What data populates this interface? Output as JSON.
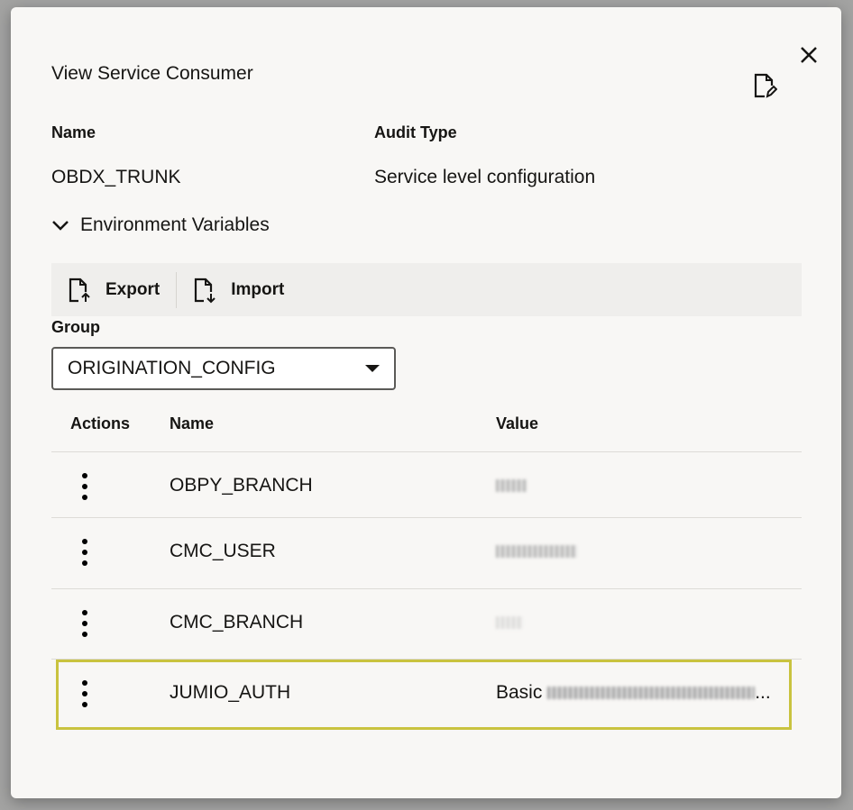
{
  "dialog": {
    "title": "View Service Consumer",
    "close_icon": "close-icon",
    "edit_icon": "edit-document-icon"
  },
  "details": {
    "name_label": "Name",
    "name_value": "OBDX_TRUNK",
    "audit_label": "Audit Type",
    "audit_value": "Service level configuration"
  },
  "env": {
    "label": "Environment Variables",
    "expanded": true
  },
  "toolbar": {
    "export_label": "Export",
    "import_label": "Import"
  },
  "group": {
    "label": "Group",
    "selected": "ORIGINATION_CONFIG"
  },
  "table": {
    "headers": [
      "Actions",
      "Name",
      "Value"
    ],
    "rows": [
      {
        "name": "OBPY_BRANCH",
        "value": ""
      },
      {
        "name": "CMC_USER",
        "value": ""
      },
      {
        "name": "CMC_BRANCH",
        "value": ""
      },
      {
        "name": "JUMIO_AUTH",
        "value": "Basic",
        "truncated": "...",
        "focused": true
      }
    ]
  },
  "colors": {
    "focus": "#c9c33f",
    "dialog_bg": "#f8f7f5"
  }
}
